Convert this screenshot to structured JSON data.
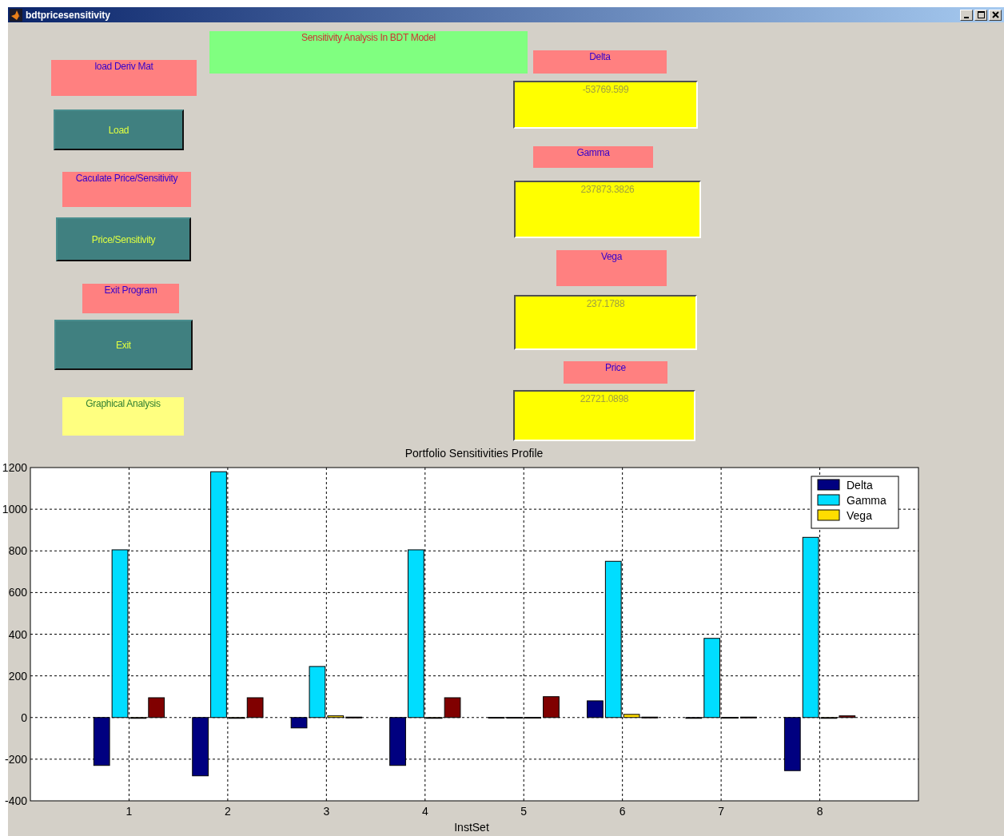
{
  "window": {
    "title": "bdtpricesensitivity"
  },
  "heading": "Sensitivity  Analysis In BDT Model",
  "controls": [
    {
      "kind": "label",
      "text": "load Deriv Mat"
    },
    {
      "kind": "button",
      "text": "Load"
    },
    {
      "kind": "label",
      "text": "Caculate Price/Sensitivity"
    },
    {
      "kind": "button",
      "text": "Price/Sensitivity"
    },
    {
      "kind": "label",
      "text": "Exit Program"
    },
    {
      "kind": "button",
      "text": "Exit"
    },
    {
      "kind": "caption",
      "text": "Graphical Analysis"
    }
  ],
  "results": [
    {
      "label": "Delta",
      "value": "-53769.599"
    },
    {
      "label": "Gamma",
      "value": "237873.3826"
    },
    {
      "label": "Vega",
      "value": "237.1788"
    },
    {
      "label": "Price",
      "value": "22721.0898"
    }
  ],
  "chart": {
    "chart_data": {
      "type": "bar",
      "title": "Portfolio Sensitivities Profile",
      "xlabel": "InstSet",
      "categories": [
        "1",
        "2",
        "3",
        "4",
        "5",
        "6",
        "7",
        "8"
      ],
      "series": [
        {
          "name": "Delta",
          "color": "#000080",
          "values": [
            -230,
            -280,
            -50,
            -230,
            1,
            80,
            0,
            -255
          ]
        },
        {
          "name": "Gamma",
          "color": "#00ddff",
          "values": [
            805,
            1180,
            245,
            805,
            1,
            750,
            380,
            865
          ]
        },
        {
          "name": "Vega",
          "color": "#ffdd00",
          "values": [
            0,
            0,
            8,
            0,
            1,
            15,
            1,
            0
          ]
        },
        {
          "color": "#800000",
          "values": [
            95,
            95,
            2,
            95,
            100,
            2,
            2,
            8
          ]
        }
      ],
      "ylim": [
        -400,
        1200
      ],
      "grid": true,
      "legend": true,
      "yticks": [
        -400,
        -200,
        0,
        200,
        400,
        600,
        800,
        1000,
        1200
      ]
    }
  }
}
